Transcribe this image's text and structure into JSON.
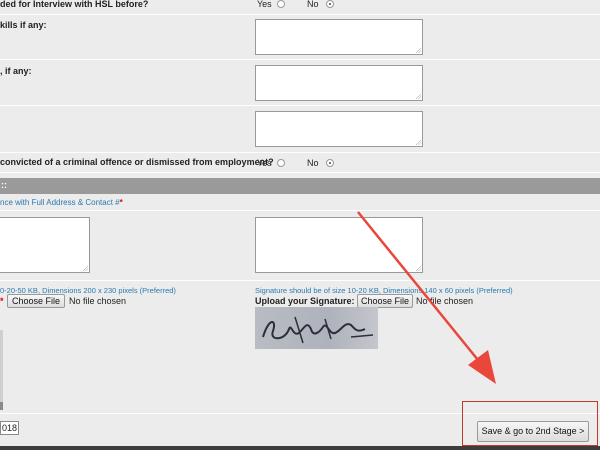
{
  "questions": [
    {
      "label": "ded for Interview with HSL before?",
      "yes": "Yes",
      "no": "No",
      "selected": "No"
    },
    {
      "label": "kills if any:"
    },
    {
      "label": ", if any:"
    },
    {
      "label": ""
    },
    {
      "label": "convicted of a criminal offence or dismissed from employment?",
      "yes": "Yes",
      "no": "No",
      "selected": "No"
    }
  ],
  "section": {
    "title": "::"
  },
  "reference": {
    "label": "nce with Full Address & Contact #",
    "required_mark": "*"
  },
  "photo": {
    "hint": "0-20-50 KB, Dimensions 200 x 230 pixels (Preferred)",
    "required_mark": "*",
    "choose_file": "Choose File",
    "no_file": "No file chosen"
  },
  "signature": {
    "hint": "Signature should be of size 10-20 KB, Dimensions 140 x 60 pixels (Preferred)",
    "label": "Upload your Signature:",
    "required_mark": "*",
    "choose_file": "Choose File",
    "no_file": "No file chosen"
  },
  "year_field": {
    "value": "018"
  },
  "submit": {
    "label": "Save & go to 2nd Stage >"
  },
  "colors": {
    "arrow": "#e8473a",
    "highlight": "#c0392b",
    "hint": "#2a7ab0",
    "required": "#e0001a"
  }
}
